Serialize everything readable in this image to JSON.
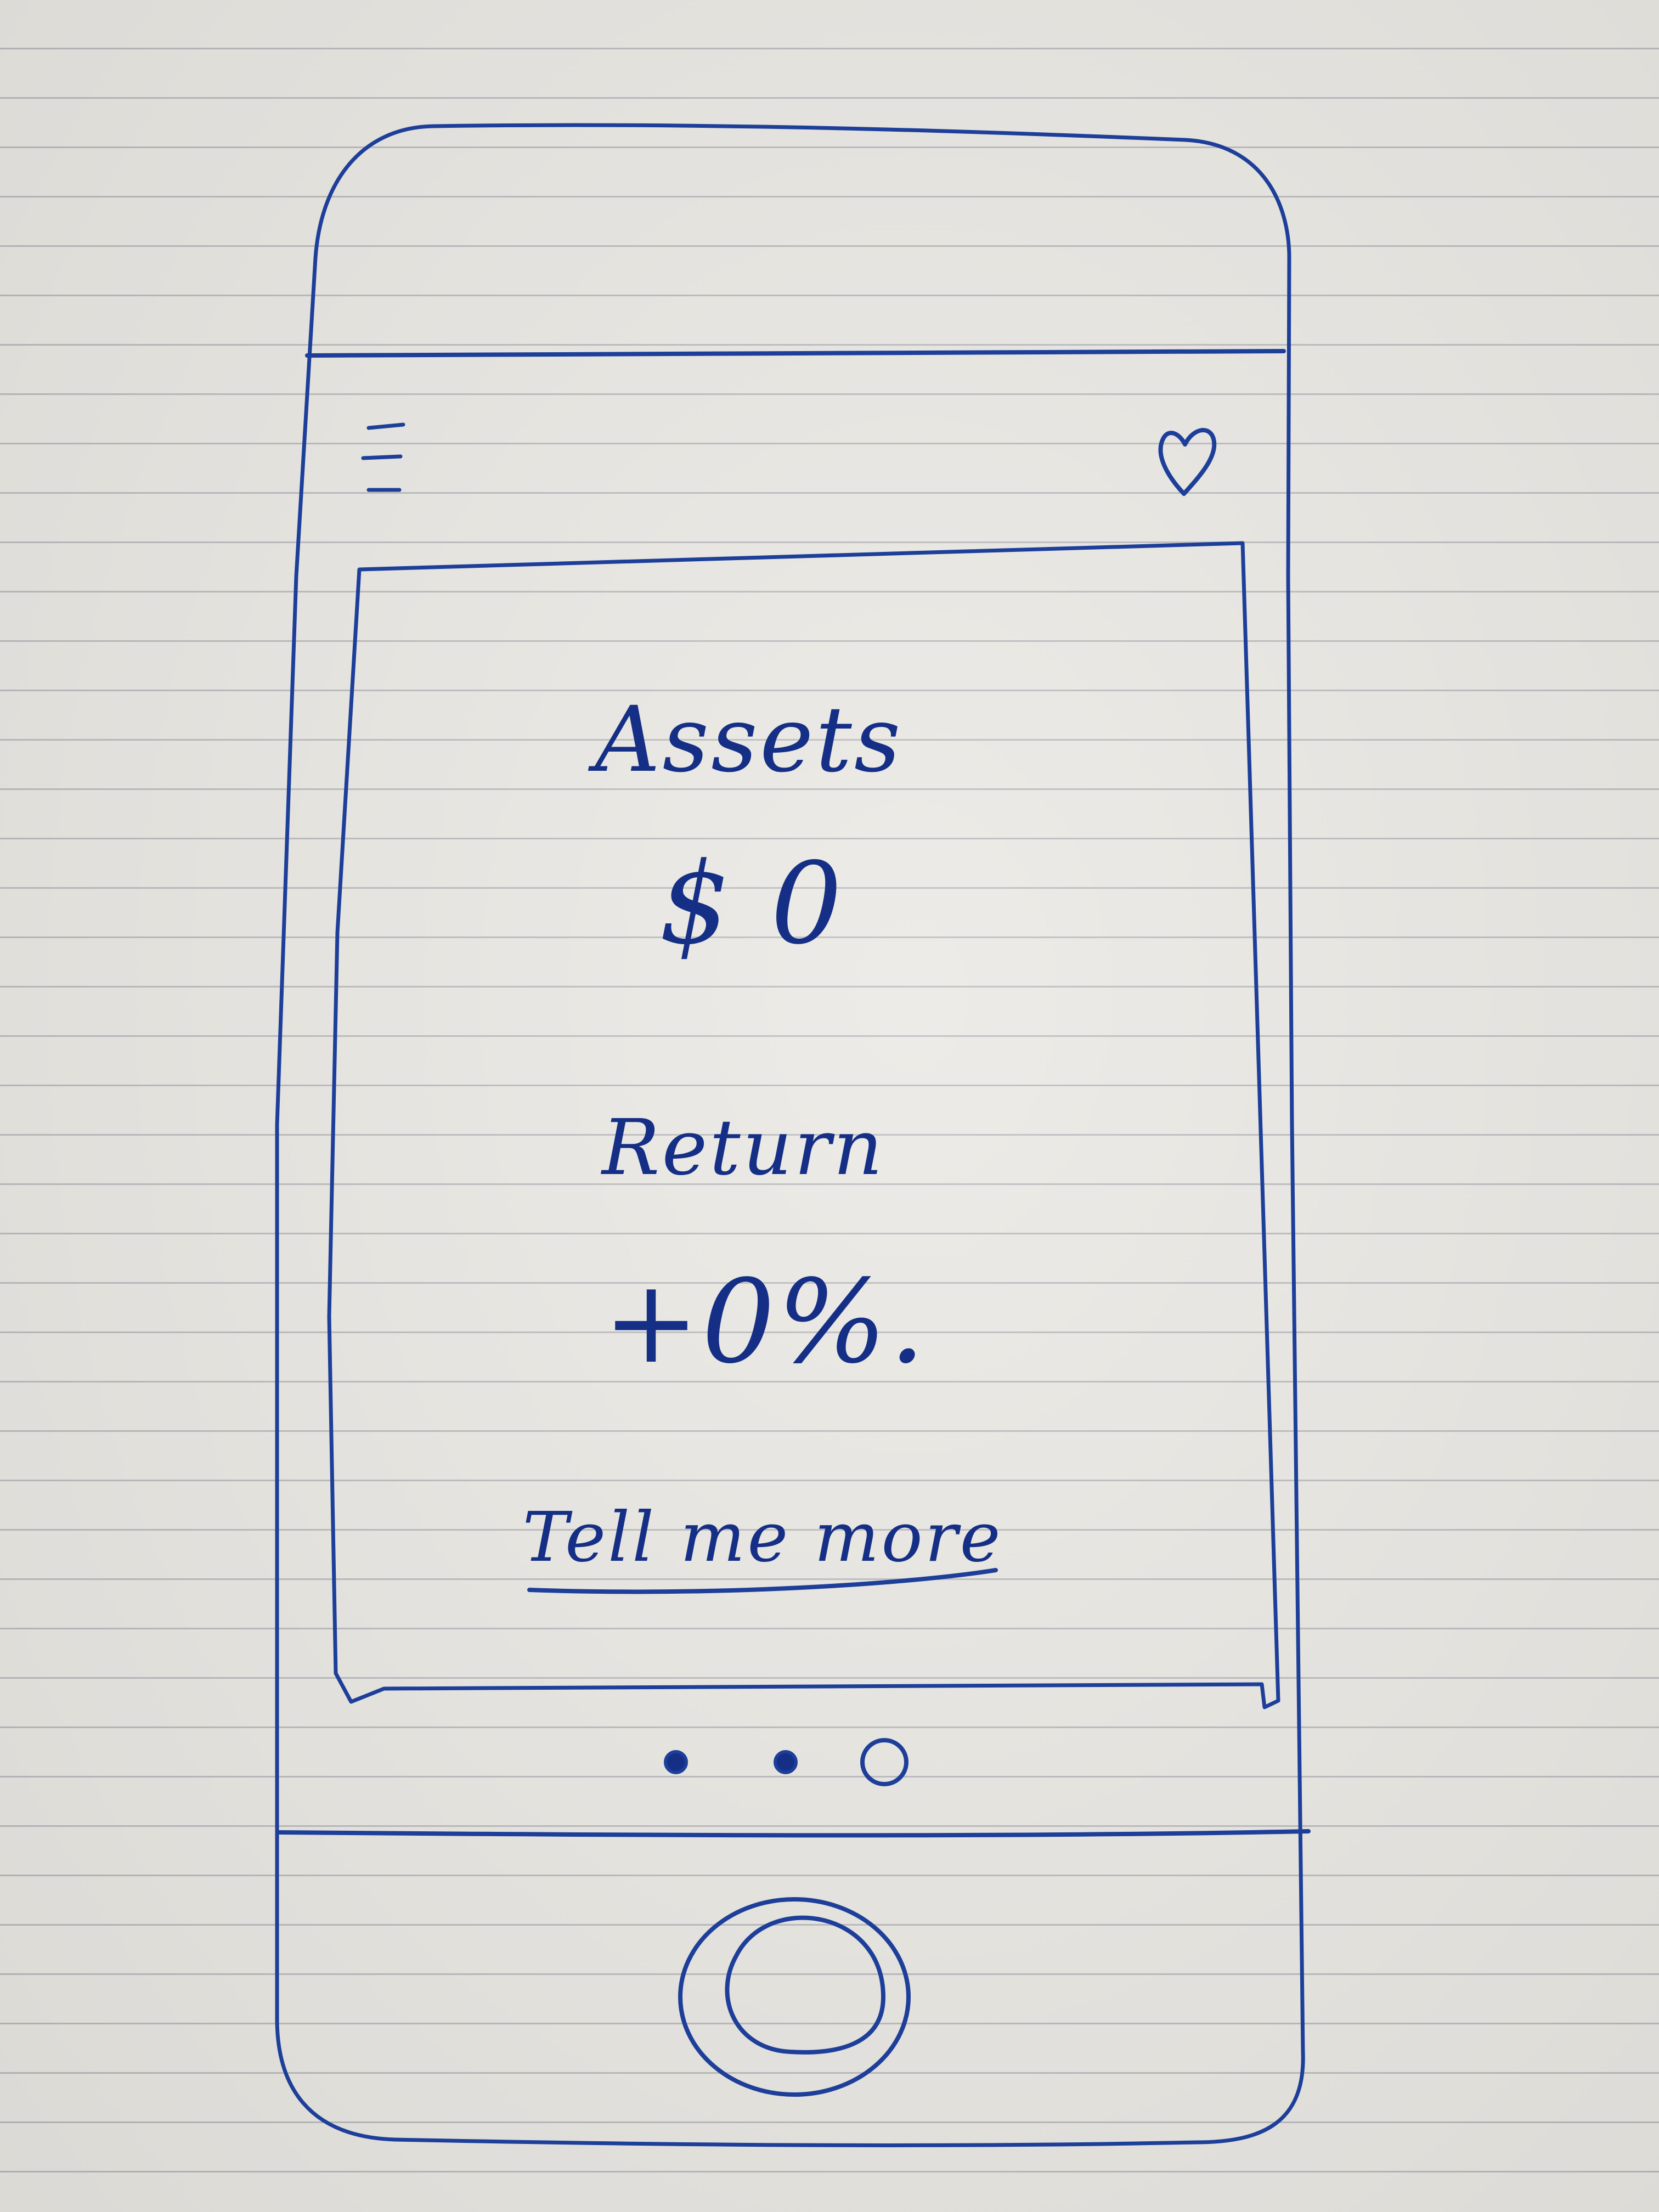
{
  "assets": {
    "label": "Assets",
    "value": "$ 0"
  },
  "return": {
    "label": "Return",
    "value": "+0%."
  },
  "cta": {
    "label": "Tell me more"
  },
  "icons": {
    "menu": "hamburger-menu-icon",
    "favorite": "heart-icon"
  },
  "carousel": {
    "total_dots": 3,
    "active_index": 2
  },
  "colors": {
    "ink": "#1d3f9a",
    "paper": "#e9e7e2"
  }
}
